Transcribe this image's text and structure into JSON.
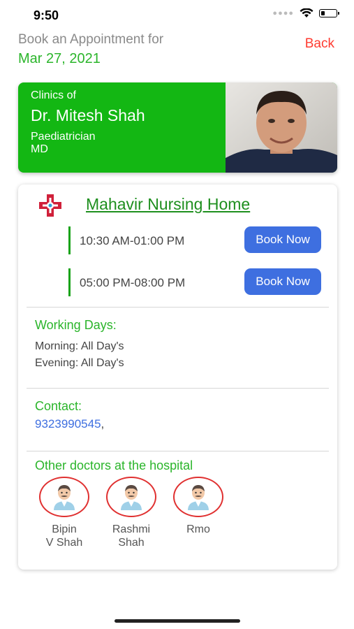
{
  "status": {
    "time": "9:50"
  },
  "header": {
    "prompt": "Book an Appointment for",
    "date": "Mar 27, 2021",
    "back_label": "Back"
  },
  "doctor": {
    "clinics_of_label": "Clinics of",
    "name": "Dr. Mitesh Shah",
    "specialty": "Paediatrician",
    "degree": "MD"
  },
  "clinic": {
    "name": "Mahavir Nursing Home",
    "slots": [
      {
        "time": "10:30 AM-01:00 PM",
        "button": "Book Now"
      },
      {
        "time": "05:00 PM-08:00 PM",
        "button": "Book Now"
      }
    ],
    "working_days": {
      "title": "Working Days:",
      "morning": "Morning: All Day's",
      "evening": "Evening: All Day's"
    },
    "contact": {
      "title": "Contact:",
      "phone": "9323990545",
      "suffix": ","
    },
    "other_doctors": {
      "title": "Other doctors at the hospital",
      "doctors": [
        {
          "line1": "Bipin",
          "line2": "V Shah"
        },
        {
          "line1": "Rashmi",
          "line2": "Shah"
        },
        {
          "line1": "Rmo",
          "line2": ""
        }
      ]
    }
  },
  "colors": {
    "green_primary": "#13b713",
    "green_text": "#2bb52b",
    "link_green": "#1e8f1e",
    "button_blue": "#3e6fe0",
    "back_red": "#ff3b30",
    "avatar_ring": "#e03030"
  },
  "icons": {
    "clinic_logo": "medical-cross-icon",
    "doctor_avatar": "doctor-icon"
  }
}
